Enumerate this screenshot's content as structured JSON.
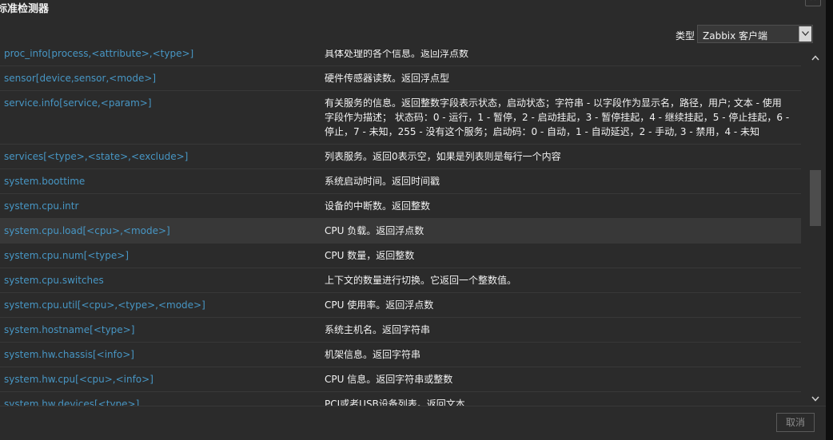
{
  "dialog": {
    "title": "标准检测器",
    "close_label": "✕"
  },
  "type_filter": {
    "label": "类型",
    "selected": "Zabbix 客户端"
  },
  "items": [
    {
      "key": "proc_info[process,<attribute>,<type>]",
      "desc": "具体处理的各个信息。返回浮点数"
    },
    {
      "key": "sensor[device,sensor,<mode>]",
      "desc": "硬件传感器读数。返回浮点型"
    },
    {
      "key": "service.info[service,<param>]",
      "desc": "有关服务的信息。返回整数字段表示状态，启动状态；字符串 - 以字段作为显示名，路径，用户; 文本 - 使用字段作为描述； 状态码：0 - 运行，1 - 暂停，2 - 启动挂起，3 - 暂停挂起，4 - 继续挂起，5 - 停止挂起，6 - 停止，7 - 未知，255 - 没有这个服务；启动码：0 - 自动，1 - 自动延迟，2 - 手动, 3 - 禁用，4 - 未知"
    },
    {
      "key": "services[<type>,<state>,<exclude>]",
      "desc": "列表服务。返回0表示空，如果是列表则是每行一个内容"
    },
    {
      "key": "system.boottime",
      "desc": "系统启动时间。返回时间戳"
    },
    {
      "key": "system.cpu.intr",
      "desc": "设备的中断数。返回整数"
    },
    {
      "key": "system.cpu.load[<cpu>,<mode>]",
      "desc": "CPU 负载。返回浮点数"
    },
    {
      "key": "system.cpu.num[<type>]",
      "desc": "CPU 数量，返回整数"
    },
    {
      "key": "system.cpu.switches",
      "desc": "上下文的数量进行切换。它返回一个整数值。"
    },
    {
      "key": "system.cpu.util[<cpu>,<type>,<mode>]",
      "desc": "CPU 使用率。返回浮点数"
    },
    {
      "key": "system.hostname[<type>]",
      "desc": "系统主机名。返回字符串"
    },
    {
      "key": "system.hw.chassis[<info>]",
      "desc": "机架信息。返回字符串"
    },
    {
      "key": "system.hw.cpu[<cpu>,<info>]",
      "desc": "CPU 信息。返回字符串或整数"
    },
    {
      "key": "system.hw.devices[<type>]",
      "desc": "PCI或者USB设备列表。返回文本"
    }
  ],
  "footer": {
    "cancel_label": "取消"
  },
  "colors": {
    "background": "#2b2b2b",
    "link": "#4796c4",
    "text": "#f2f2f2",
    "row_highlight": "#383838"
  }
}
